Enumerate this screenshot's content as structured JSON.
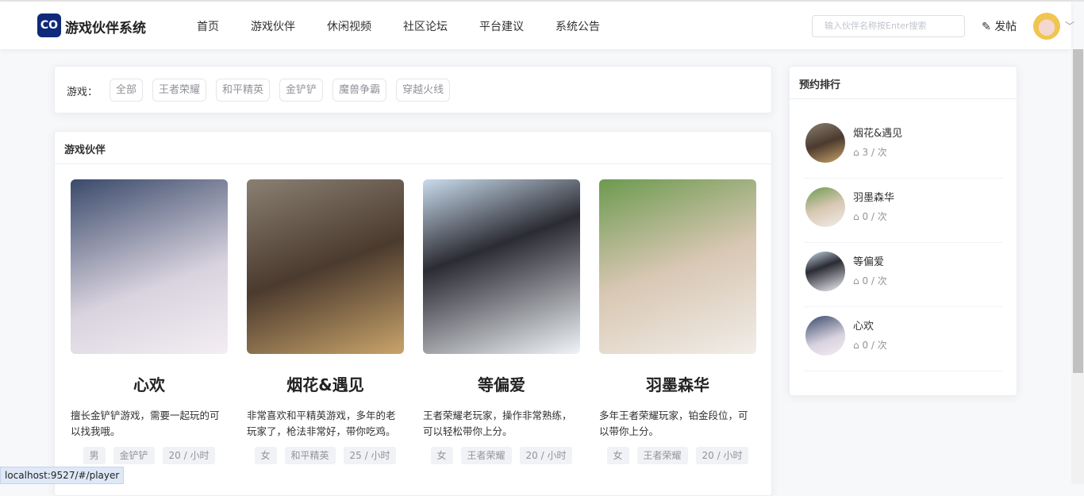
{
  "header": {
    "logo_text": "CO",
    "brand": "游戏伙伴系统",
    "nav": [
      "首页",
      "游戏伙伴",
      "休闲视频",
      "社区论坛",
      "平台建议",
      "系统公告"
    ],
    "search_placeholder": "输入伙伴名称按Enter搜索",
    "post_label": "发帖",
    "post_icon": "edit-icon"
  },
  "filter": {
    "label": "游戏：",
    "items": [
      "全部",
      "王者荣耀",
      "和平精英",
      "金铲铲",
      "魔兽争霸",
      "穿越火线"
    ]
  },
  "partners": {
    "title": "游戏伙伴",
    "items": [
      {
        "name": "心欢",
        "desc": "擅长金铲铲游戏，需要一起玩的可以找我哦。",
        "tags": [
          "男",
          "金铲铲",
          "20 / 小时"
        ]
      },
      {
        "name": "烟花&遇见",
        "desc": "非常喜欢和平精英游戏，多年的老玩家了，枪法非常好，带你吃鸡。",
        "tags": [
          "女",
          "和平精英",
          "25 / 小时"
        ]
      },
      {
        "name": "等偏爱",
        "desc": "王者荣耀老玩家，操作非常熟练，可以轻松带你上分。",
        "tags": [
          "女",
          "王者荣耀",
          "20 / 小时"
        ]
      },
      {
        "name": "羽墨森华",
        "desc": "多年王者荣耀玩家，铂金段位，可以带你上分。",
        "tags": [
          "女",
          "王者荣耀",
          "20 / 小时"
        ]
      }
    ]
  },
  "ranking": {
    "title": "预约排行",
    "items": [
      {
        "name": "烟花&遇见",
        "count": "3 / 次"
      },
      {
        "name": "羽墨森华",
        "count": "0 / 次"
      },
      {
        "name": "等偏爱",
        "count": "0 / 次"
      },
      {
        "name": "心欢",
        "count": "0 / 次"
      }
    ]
  },
  "status_url": "localhost:9527/#/player"
}
